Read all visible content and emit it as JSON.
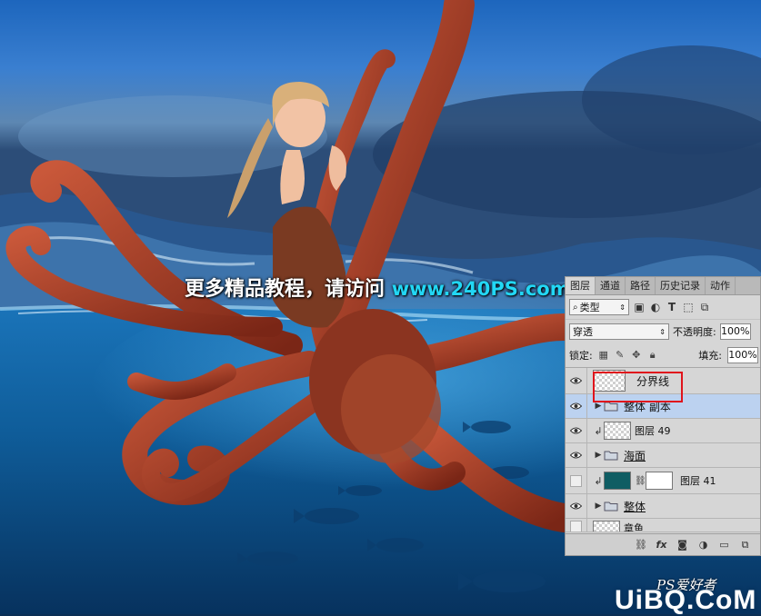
{
  "overlay": {
    "promo_text": "更多精品教程，请访问",
    "promo_url": "www.240PS.com"
  },
  "layers_panel": {
    "tabs": [
      "图层",
      "通道",
      "路径",
      "历史记录",
      "动作"
    ],
    "kind_filter": "类型",
    "blend_mode": "穿透",
    "opacity_label": "不透明度:",
    "opacity_value": "100%",
    "lock_label": "锁定:",
    "fill_label": "填充:",
    "fill_value": "100%",
    "layers": [
      {
        "name": "分界线",
        "type": "layer",
        "visible": true,
        "selected": false
      },
      {
        "name": "整体 副本",
        "type": "group",
        "visible": true,
        "selected": true
      },
      {
        "name": "图层 49",
        "type": "layer",
        "visible": true,
        "clipped": true
      },
      {
        "name": "海面",
        "type": "group",
        "visible": true
      },
      {
        "name": "图层 41",
        "type": "adjustment",
        "visible": false,
        "clipped": true
      },
      {
        "name": "整体",
        "type": "group",
        "visible": true
      },
      {
        "name": "章鱼",
        "type": "layer",
        "visible": false
      }
    ]
  },
  "watermark": {
    "ps_text": "PS爱好者",
    "site_text": "UiBQ.CoM"
  },
  "colors": {
    "highlight": "#e0141c",
    "selected_row": "#bcd2f0",
    "url": "#22d7f5"
  }
}
